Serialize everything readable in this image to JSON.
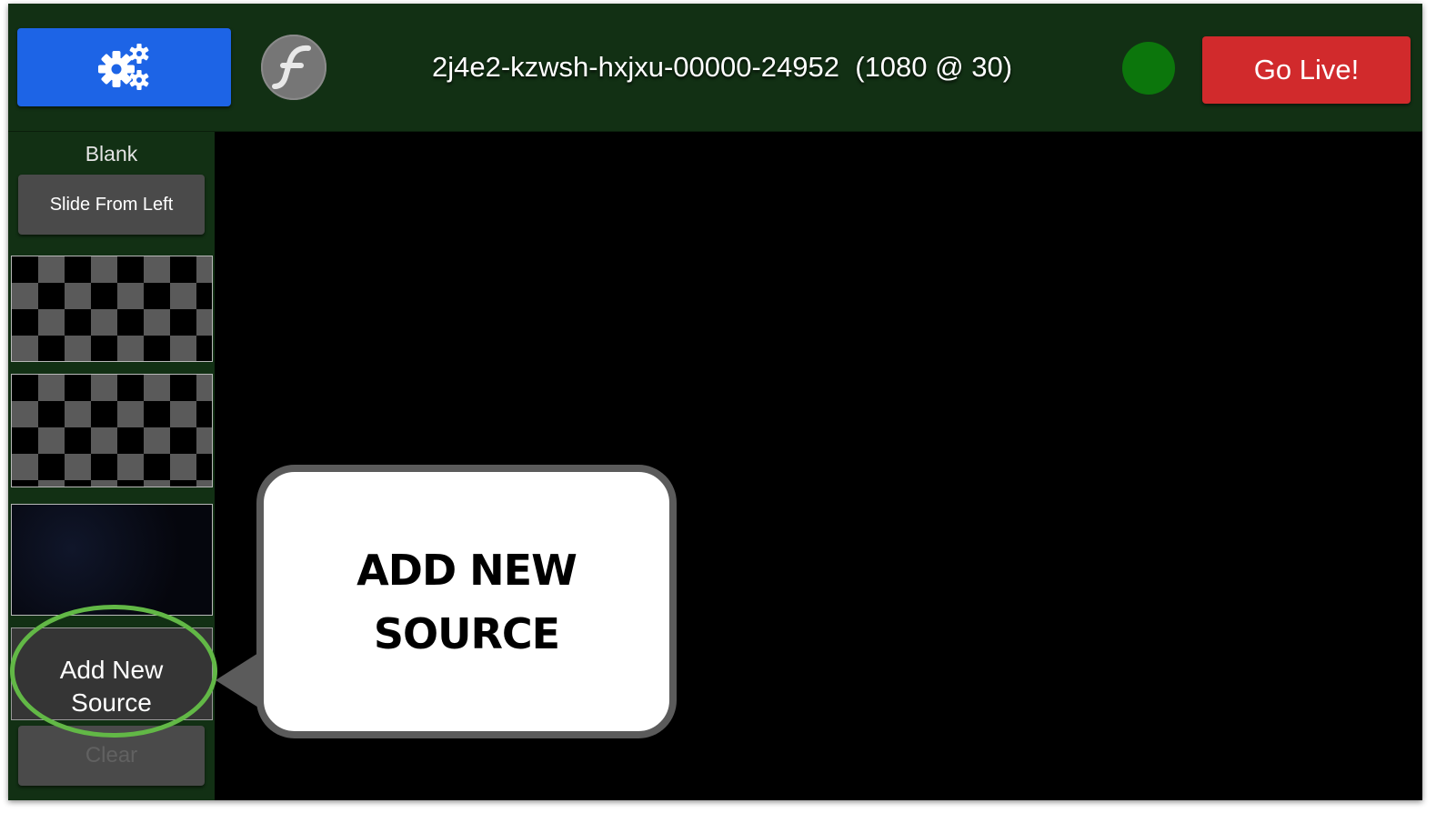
{
  "topbar": {
    "settings_icon": "gears-icon",
    "flash_logo_icon": "flash-icon",
    "stream_id": "2j4e2-kzwsh-hxjxu-00000-24952  (1080 @ 30)",
    "status_color": "#0c760c",
    "go_live_label": "Go Live!"
  },
  "sidebar": {
    "blank_label": "Blank",
    "slide_button": "Slide From Left",
    "add_source_label": "Add New\nSource",
    "clear_button": "Clear"
  },
  "callout": {
    "text": "ADD NEW\nSOURCE"
  },
  "colors": {
    "topbar_bg": "#123014",
    "settings_blue": "#1d64e6",
    "go_live_red": "#d12a2c",
    "highlight_green": "#62b846"
  }
}
